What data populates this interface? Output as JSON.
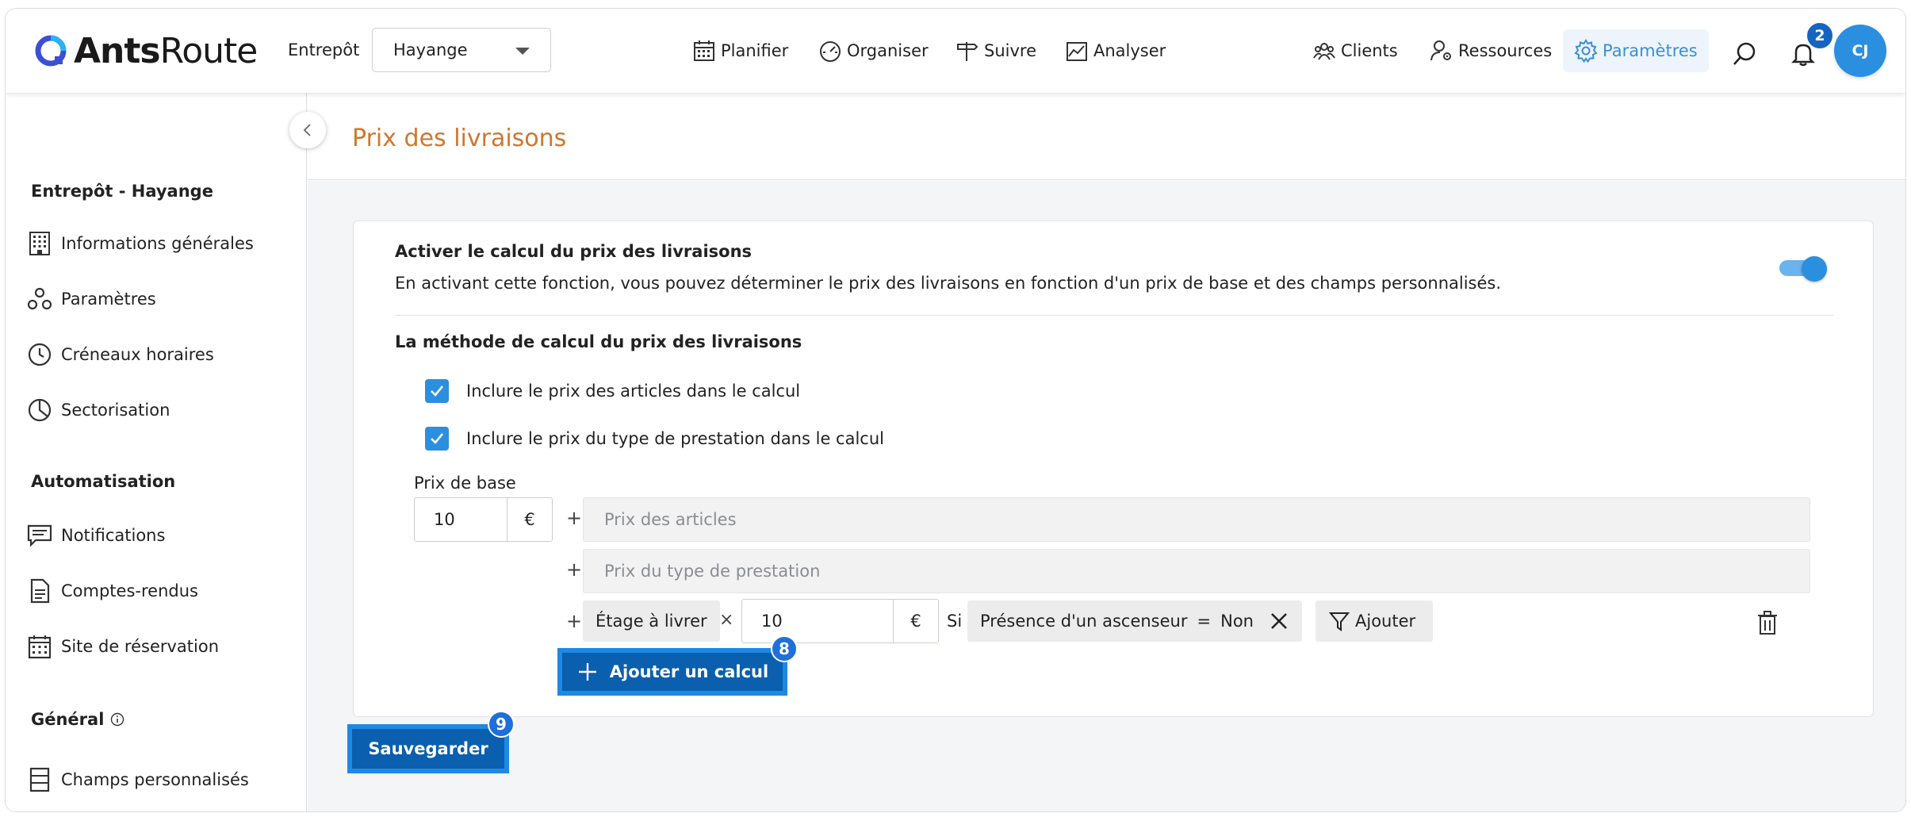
{
  "app": {
    "logo_text_bold": "Ants",
    "logo_text": "Route",
    "warehouse_label": "Entrepôt",
    "warehouse_value": "Hayange",
    "notification_count": "2",
    "avatar_initials": "CJ"
  },
  "nav": {
    "planifier": "Planifier",
    "organiser": "Organiser",
    "suivre": "Suivre",
    "analyser": "Analyser",
    "clients": "Clients",
    "ressources": "Ressources",
    "parametres": "Paramètres"
  },
  "sidebar": {
    "section1": "Entrepôt - Hayange",
    "items1": [
      "Informations générales",
      "Paramètres",
      "Créneaux horaires",
      "Sectorisation"
    ],
    "section2": "Automatisation",
    "items2": [
      "Notifications",
      "Comptes-rendus",
      "Site de réservation"
    ],
    "section3": "Général",
    "items3": [
      "Champs personnalisés"
    ]
  },
  "page": {
    "title": "Prix des livraisons"
  },
  "card": {
    "title": "Activer le calcul du prix des livraisons",
    "description": "En activant cette fonction, vous pouvez déterminer le prix des livraisons en fonction d'un prix de base et des champs personnalisés.",
    "toggle_on": true,
    "method_title": "La méthode de calcul du prix des livraisons",
    "checkbox1": "Inclure le prix des articles dans le calcul",
    "checkbox2": "Inclure le prix du type de prestation dans le calcul",
    "base_label": "Prix de base",
    "base_value": "10",
    "currency": "€",
    "plus": "+",
    "field_articles": "Prix des articles",
    "field_prestation": "Prix du type de prestation",
    "custom_field": "Étage à livrer",
    "times": "×",
    "multiplier_value": "10",
    "si": "Si",
    "condition_field": "Présence d'un ascenseur",
    "condition_op": "=",
    "condition_value": "Non",
    "filter_add": "Ajouter",
    "add_calc": "Ajouter un calcul",
    "badge_add_calc": "8"
  },
  "footer": {
    "save": "Sauvegarder",
    "badge_save": "9"
  },
  "colors": {
    "accent": "#2b8fe0",
    "title_orange": "#d0772d",
    "primary_button": "#0a5fae"
  }
}
